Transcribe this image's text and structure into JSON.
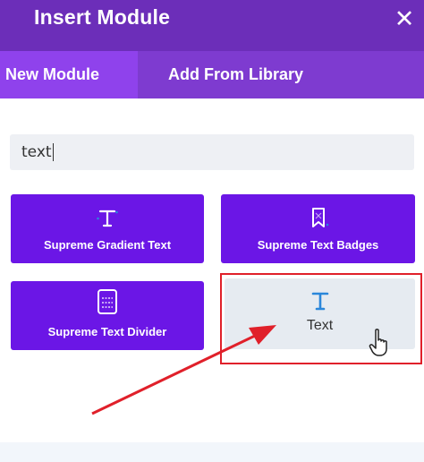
{
  "header": {
    "title": "Insert Module",
    "close_icon": "close-icon"
  },
  "tabs": [
    {
      "label": "New Module",
      "active": true
    },
    {
      "label": "Add From Library",
      "active": false
    }
  ],
  "search": {
    "value": "text"
  },
  "modules": [
    {
      "label": "Supreme Gradient Text",
      "icon": "text-icon"
    },
    {
      "label": "Supreme Text Badges",
      "icon": "bookmark-icon"
    },
    {
      "label": "Supreme Text Divider",
      "icon": "divider-icon"
    },
    {
      "label": "Text",
      "icon": "text-icon",
      "hovered": true
    }
  ],
  "colors": {
    "header": "#6c2eb9",
    "tabs": "#7e3bd0",
    "active_tab": "#8f42ec",
    "module": "#6b16e6",
    "highlight": "#e0202a",
    "hover_module": "#e6ebf1",
    "text_icon": "#2b87da"
  }
}
